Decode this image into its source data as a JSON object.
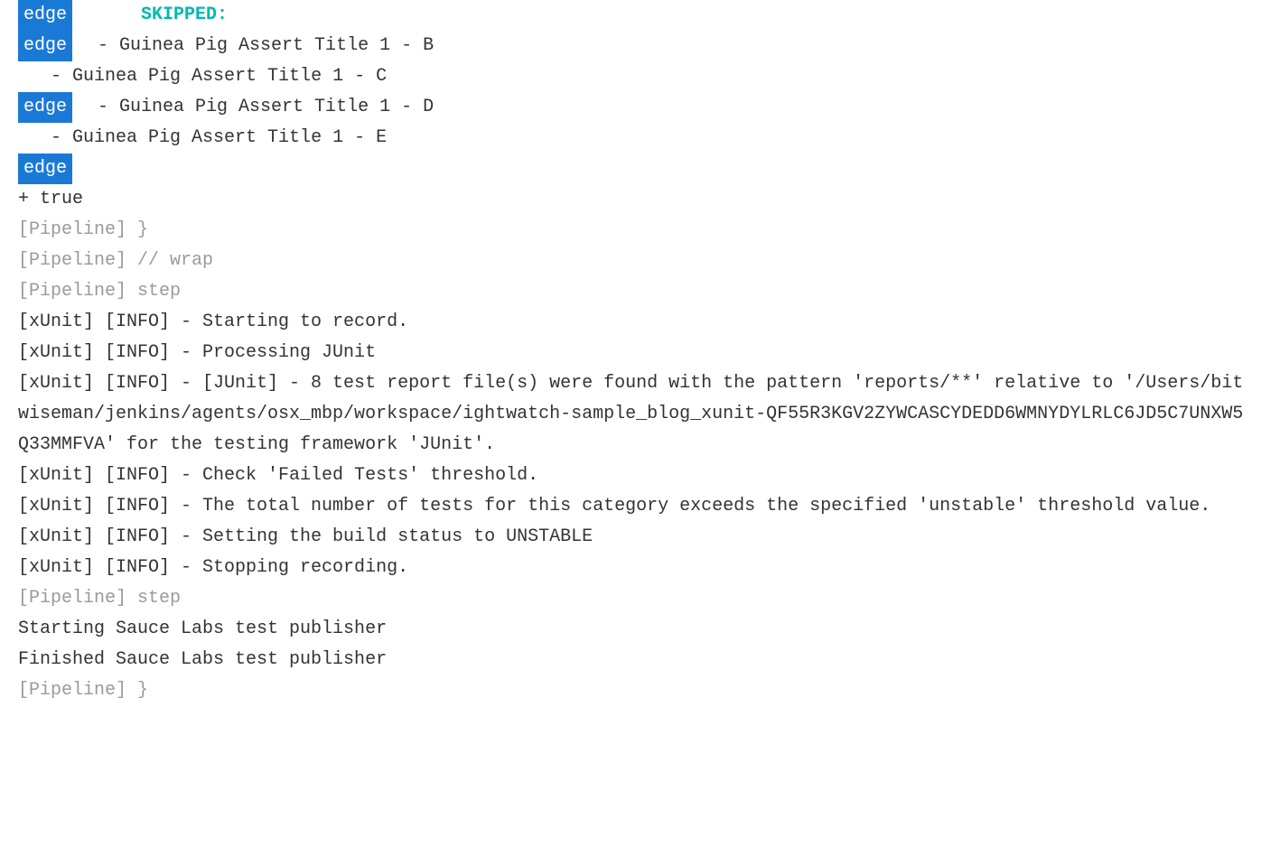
{
  "badges": {
    "edge": "edge"
  },
  "lines": {
    "l0_skipped": "      SKIPPED:",
    "l1": "  - Guinea Pig Assert Title 1 - B",
    "l2": "   - Guinea Pig Assert Title 1 - C",
    "l3": "  - Guinea Pig Assert Title 1 - D",
    "l4": "   - Guinea Pig Assert Title 1 - E",
    "l5_true": "+ true",
    "l6": "[Pipeline] }",
    "l7": "[Pipeline] // wrap",
    "l8": "[Pipeline] step",
    "l9": "[xUnit] [INFO] - Starting to record.",
    "l10": "[xUnit] [INFO] - Processing JUnit",
    "l11": "[xUnit] [INFO] - [JUnit] - 8 test report file(s) were found with the pattern 'reports/**' relative to '/Users/bitwiseman/jenkins/agents/osx_mbp/workspace/ightwatch-sample_blog_xunit-QF55R3KGV2ZYWCASCYDEDD6WMNYDYLRLC6JD5C7UNXW5Q33MMFVA' for the testing framework 'JUnit'.",
    "l12": "[xUnit] [INFO] - Check 'Failed Tests' threshold.",
    "l13": "[xUnit] [INFO] - The total number of tests for this category exceeds the specified 'unstable' threshold value.",
    "l14": "[xUnit] [INFO] - Setting the build status to UNSTABLE",
    "l15": "[xUnit] [INFO] - Stopping recording.",
    "l16": "[Pipeline] step",
    "l17": "Starting Sauce Labs test publisher",
    "l18": "Finished Sauce Labs test publisher",
    "l19": "[Pipeline] }"
  }
}
